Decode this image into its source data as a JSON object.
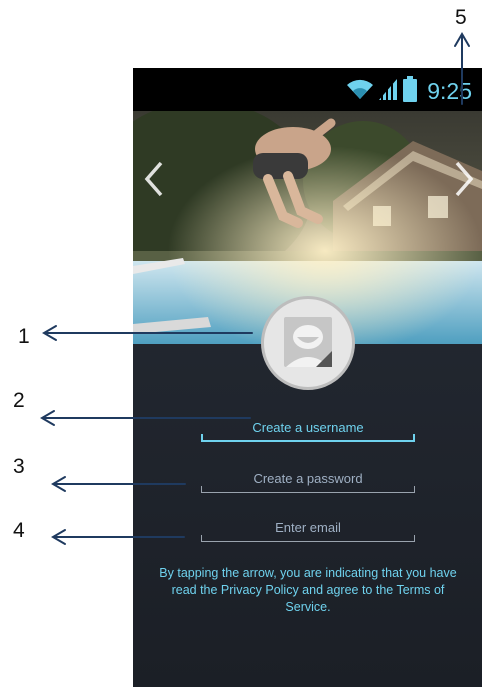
{
  "callouts": [
    "1",
    "2",
    "3",
    "4",
    "5"
  ],
  "status": {
    "time": "9:25"
  },
  "form": {
    "username_placeholder": "Create a username",
    "password_placeholder": "Create a password",
    "email_placeholder": "Enter email"
  },
  "terms_text": "By tapping the arrow, you are indicating that you have read the Privacy Policy and agree to the Terms of Service.",
  "colors": {
    "accent": "#6fd2ee",
    "background": "#222730",
    "status_bar": "#000000"
  }
}
